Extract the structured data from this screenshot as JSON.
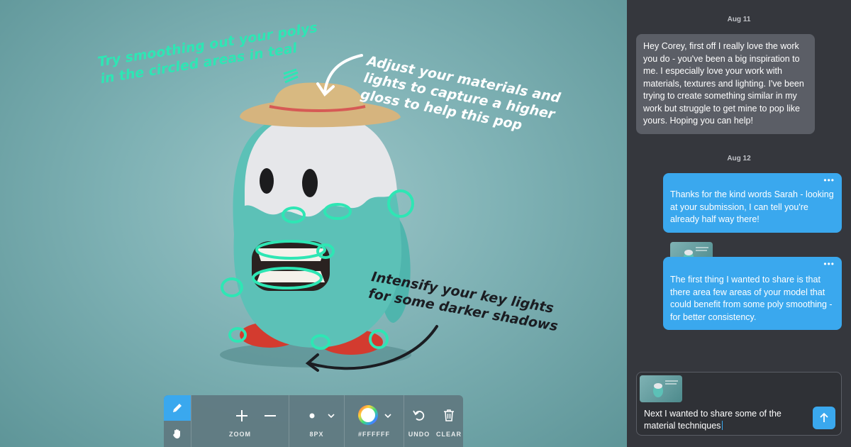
{
  "canvas": {
    "annotations": {
      "teal": "Try smoothing out your polys\nin the circled areas in teal",
      "white": "Adjust your materials and\nlights to capture a higher\ngloss to help this pop",
      "black": "Intensify your key lights\nfor some darker shadows"
    },
    "accent_teal": "#2ee6b4"
  },
  "toolbar": {
    "tools": {
      "pen": "pencil-icon",
      "pan": "hand-icon"
    },
    "zoom_label": "ZOOM",
    "size_label": "8PX",
    "color_label": "#FFFFFF",
    "undo_label": "UNDO",
    "clear_label": "CLEAR"
  },
  "chat": {
    "messages": [
      {
        "date": "Aug 11"
      },
      {
        "text": "Hey Corey, first off I really love the work you do - you've been a big inspiration to me. I especially love your work with materials, textures and lighting. I've been trying to create something similar in my work but struggle to get mine to pop like yours. Hoping you can help!"
      },
      {
        "date": "Aug 12"
      },
      {
        "text": "Thanks for the kind words Sarah - looking at your submission, I can tell you're already half way there!"
      },
      {
        "text": "The first thing I wanted to share is that there area few areas of your model that could benefit from some poly smoothing - for better consistency."
      }
    ],
    "more_icon": "•••",
    "composer_text": "Next I wanted to share some of the material techniques",
    "accent_blue": "#3aa8ee"
  }
}
